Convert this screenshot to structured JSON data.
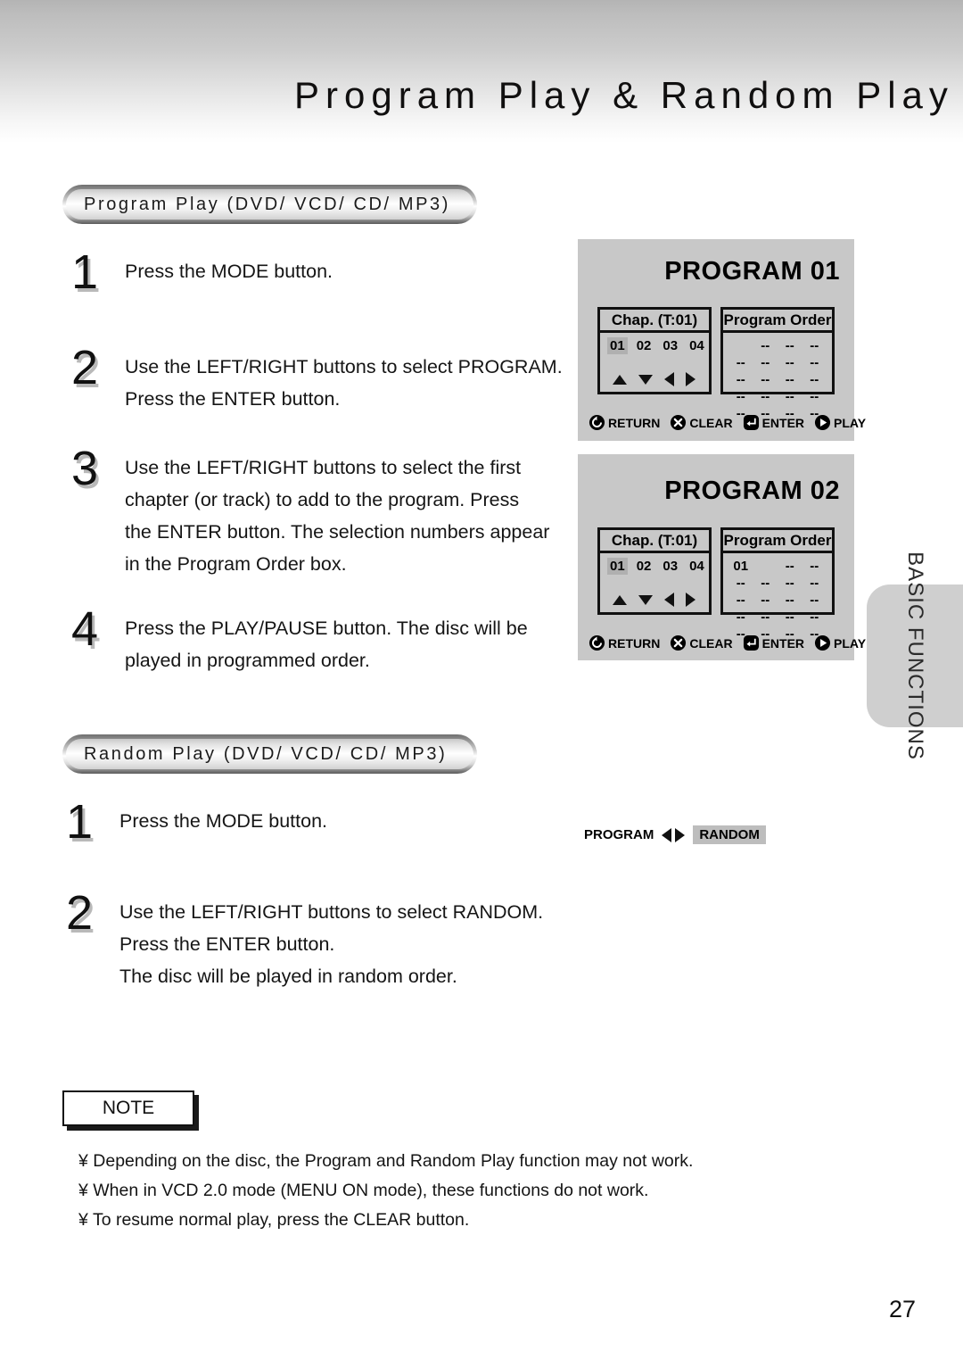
{
  "page": {
    "title": "Program Play & Random Play",
    "number": "27",
    "side_tab": "BASIC FUNCTIONS"
  },
  "sections": [
    {
      "heading": "Program Play (DVD/ VCD/ CD/ MP3)",
      "steps": [
        {
          "num": "1",
          "text": "Press the MODE button."
        },
        {
          "num": "2",
          "text": "Use the LEFT/RIGHT buttons to select PROGRAM.\nPress the ENTER button."
        },
        {
          "num": "3",
          "text": "Use the LEFT/RIGHT buttons to select the first\nchapter (or track) to add to the program. Press\nthe ENTER button. The selection numbers appear\nin the Program Order box."
        },
        {
          "num": "4",
          "text": "Press the PLAY/PAUSE button. The disc will be\nplayed in programmed order."
        }
      ]
    },
    {
      "heading": "Random Play (DVD/ VCD/ CD/ MP3)",
      "steps": [
        {
          "num": "1",
          "text": "Press the MODE button."
        },
        {
          "num": "2",
          "text": "Use the LEFT/RIGHT buttons to select RANDOM.\nPress the ENTER button."
        }
      ],
      "extra_line": "The disc will be played in random order."
    }
  ],
  "osd_screens": [
    {
      "title": "PROGRAM 01",
      "chap_header": "Chap. (T:01)",
      "chap_numbers": [
        "01",
        "02",
        "03",
        "04"
      ],
      "chap_selected_index": 0,
      "order_header": "Program Order",
      "order_cells": [
        "",
        "--",
        "--",
        "--",
        "--",
        "--",
        "--",
        "--",
        "--",
        "--",
        "--",
        "--",
        "--",
        "--",
        "--",
        "--",
        "--",
        "--",
        "--",
        "--"
      ],
      "legend": [
        "RETURN",
        "CLEAR",
        "ENTER",
        "PLAY"
      ]
    },
    {
      "title": "PROGRAM 02",
      "chap_header": "Chap. (T:01)",
      "chap_numbers": [
        "01",
        "02",
        "03",
        "04"
      ],
      "chap_selected_index": 0,
      "order_header": "Program Order",
      "order_cells": [
        "01",
        "",
        "--",
        "--",
        "--",
        "--",
        "--",
        "--",
        "--",
        "--",
        "--",
        "--",
        "--",
        "--",
        "--",
        "--",
        "--",
        "--",
        "--",
        "--"
      ],
      "legend": [
        "RETURN",
        "CLEAR",
        "ENTER",
        "PLAY"
      ]
    }
  ],
  "mode_strip": {
    "left_label": "PROGRAM",
    "right_label": "RANDOM"
  },
  "note": {
    "badge": "NOTE",
    "bullet": "¥",
    "lines": [
      "Depending on the disc, the Program and Random Play function may not work.",
      "When in VCD 2.0 mode (MENU ON mode), these functions do not work.",
      "To resume normal play, press the CLEAR button."
    ]
  },
  "colors": {
    "osd_bg": "#c8c8c8",
    "osd_line": "#111111",
    "highlight": "#b0b0b0",
    "side_tab_bg": "#cfcfcf",
    "header_band_top": "#b4b4b4"
  }
}
